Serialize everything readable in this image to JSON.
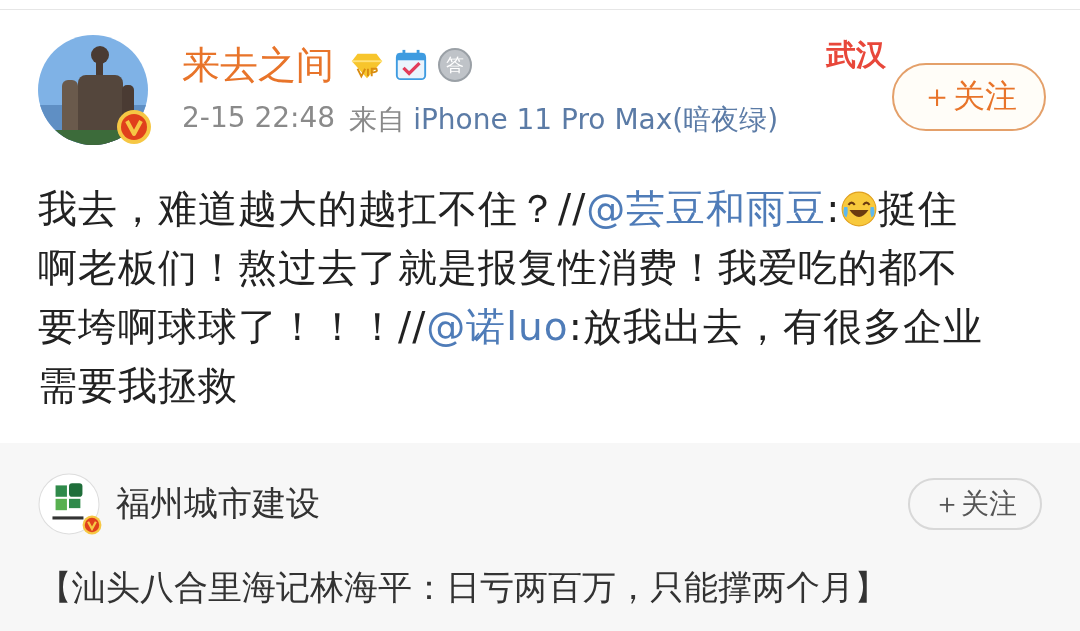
{
  "post": {
    "author": "来去之间",
    "badges": [
      {
        "kind": "vip"
      },
      {
        "kind": "checkin"
      },
      {
        "kind": "medal",
        "text": "答"
      }
    ],
    "decoration": {
      "text": "武汉"
    },
    "follow_button": "＋关注",
    "time": "2-15 22:48",
    "source_prefix": "来自",
    "source": "iPhone 11 Pro Max(暗夜绿)",
    "lines": [
      [
        {
          "kind": "text",
          "text": "我去，难道越大的越扛不住？//"
        },
        {
          "kind": "mention",
          "text": "@芸豆和雨豆"
        },
        {
          "kind": "text",
          "text": ":"
        },
        {
          "kind": "emoji"
        },
        {
          "kind": "text",
          "text": "挺住"
        }
      ],
      [
        {
          "kind": "text",
          "text": "啊老板们！熬过去了就是报复性消费！我爱吃的都不"
        }
      ],
      [
        {
          "kind": "text",
          "text": "要垮啊球球了！！！//"
        },
        {
          "kind": "mention",
          "text": "@诺luo"
        },
        {
          "kind": "text",
          "text": ":放我出去，有很多企业"
        }
      ],
      [
        {
          "kind": "text",
          "text": "需要我拯救"
        }
      ]
    ]
  },
  "repost": {
    "author": "福州城市建设",
    "follow_button": "＋关注",
    "headline": "【汕头八合里海记林海平：日亏两百万，只能撑两个月】"
  }
}
